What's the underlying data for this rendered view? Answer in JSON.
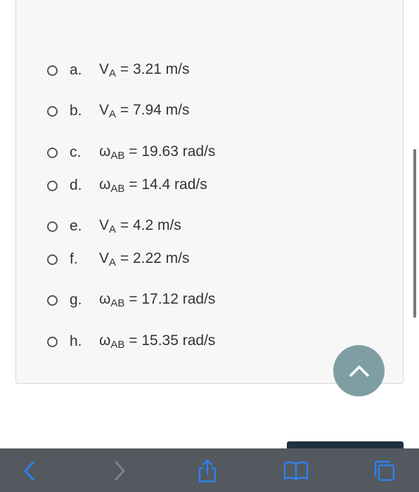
{
  "options": [
    {
      "letter": "a.",
      "symbol": "V",
      "sub": "A",
      "rest": " = 3.21 m/s"
    },
    {
      "letter": "b.",
      "symbol": "V",
      "sub": "A",
      "rest": " = 7.94 m/s"
    },
    {
      "letter": "c.",
      "symbol": "ω",
      "sub": "AB",
      "rest": " = 19.63 rad/s"
    },
    {
      "letter": "d.",
      "symbol": "ω",
      "sub": "AB",
      "rest": " = 14.4 rad/s"
    },
    {
      "letter": "e.",
      "symbol": "V",
      "sub": "A",
      "rest": " = 4.2 m/s"
    },
    {
      "letter": "f.",
      "symbol": "V",
      "sub": "A",
      "rest": " = 2.22 m/s"
    },
    {
      "letter": "g.",
      "symbol": "ω",
      "sub": "AB",
      "rest": " = 17.12 rad/s"
    },
    {
      "letter": "h.",
      "symbol": "ω",
      "sub": "AB",
      "rest": " = 15.35 rad/s"
    }
  ],
  "icons": {
    "scroll_top": "chevron-up-icon",
    "back": "chevron-left-icon",
    "forward": "chevron-right-icon",
    "share": "share-icon",
    "bookmarks": "book-icon",
    "tabs": "tabs-icon"
  },
  "colors": {
    "accent": "#2f80ed",
    "toolbar": "#54595f",
    "scroll_button": "#7f9ea3",
    "card_background": "#f7f7f7"
  }
}
